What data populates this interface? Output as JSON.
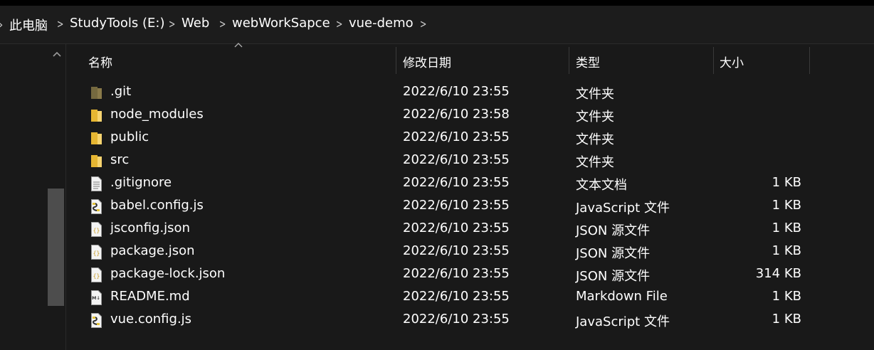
{
  "breadcrumb": [
    {
      "label": "此电脑"
    },
    {
      "label": "StudyTools (E:)"
    },
    {
      "label": "Web"
    },
    {
      "label": "webWorkSapce"
    },
    {
      "label": "vue-demo"
    }
  ],
  "columns": {
    "name": "名称",
    "date": "修改日期",
    "type": "类型",
    "size": "大小"
  },
  "files": [
    {
      "name": ".git",
      "date": "2022/6/10 23:55",
      "type": "文件夹",
      "size": "",
      "icon": "folder-hidden-icon"
    },
    {
      "name": "node_modules",
      "date": "2022/6/10 23:58",
      "type": "文件夹",
      "size": "",
      "icon": "folder-icon"
    },
    {
      "name": "public",
      "date": "2022/6/10 23:55",
      "type": "文件夹",
      "size": "",
      "icon": "folder-icon"
    },
    {
      "name": "src",
      "date": "2022/6/10 23:55",
      "type": "文件夹",
      "size": "",
      "icon": "folder-icon"
    },
    {
      "name": ".gitignore",
      "date": "2022/6/10 23:55",
      "type": "文本文档",
      "size": "1 KB",
      "icon": "text-file-icon"
    },
    {
      "name": "babel.config.js",
      "date": "2022/6/10 23:55",
      "type": "JavaScript 文件",
      "size": "1 KB",
      "icon": "js-file-icon"
    },
    {
      "name": "jsconfig.json",
      "date": "2022/6/10 23:55",
      "type": "JSON 源文件",
      "size": "1 KB",
      "icon": "json-file-icon"
    },
    {
      "name": "package.json",
      "date": "2022/6/10 23:55",
      "type": "JSON 源文件",
      "size": "1 KB",
      "icon": "json-file-icon"
    },
    {
      "name": "package-lock.json",
      "date": "2022/6/10 23:55",
      "type": "JSON 源文件",
      "size": "314 KB",
      "icon": "json-file-icon"
    },
    {
      "name": "README.md",
      "date": "2022/6/10 23:55",
      "type": "Markdown File",
      "size": "1 KB",
      "icon": "markdown-file-icon"
    },
    {
      "name": "vue.config.js",
      "date": "2022/6/10 23:55",
      "type": "JavaScript 文件",
      "size": "1 KB",
      "icon": "js-file-icon"
    }
  ],
  "colors": {
    "background": "#191919",
    "folder": "#f3c34d",
    "folder_hidden": "#8a7a4a",
    "text": "#ffffff"
  }
}
